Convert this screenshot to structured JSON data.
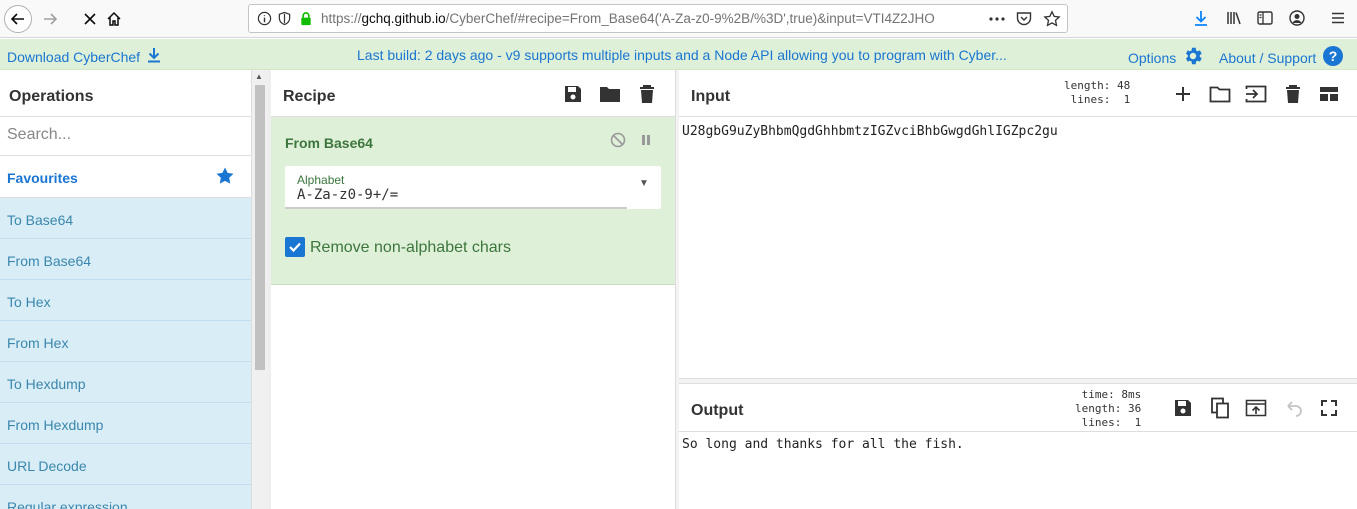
{
  "browser": {
    "url_prefix": "https://",
    "url_host": "gchq.github.io",
    "url_rest": "/CyberChef/#recipe=From_Base64('A-Za-z0-9%2B/%3D',true)&input=VTI4Z2JHO"
  },
  "banner": {
    "download_label": "Download CyberChef",
    "message": "Last build: 2 days ago - v9 supports multiple inputs and a Node API allowing you to program with Cyber...",
    "options_label": "Options",
    "about_label": "About / Support"
  },
  "operations": {
    "title": "Operations",
    "search_placeholder": "Search...",
    "favourites_label": "Favourites",
    "items": [
      "To Base64",
      "From Base64",
      "To Hex",
      "From Hex",
      "To Hexdump",
      "From Hexdump",
      "URL Decode",
      "Regular expression"
    ]
  },
  "recipe": {
    "title": "Recipe",
    "operation": {
      "name": "From Base64",
      "alphabet_label": "Alphabet",
      "alphabet_value": "A-Za-z0-9+/=",
      "remove_label": "Remove non-alphabet chars",
      "remove_checked": true
    }
  },
  "input": {
    "title": "Input",
    "info": "length: 48\n lines:  1",
    "text": "U28gbG9uZyBhbmQgdGhhbmtzIGZvciBhbGwgdGhlIGZpc2gu"
  },
  "output": {
    "title": "Output",
    "info": "time: 8ms\nlength: 36\n lines:  1",
    "text": "So long and thanks for all the fish."
  },
  "colors": {
    "accent": "#1976d2",
    "banner_bg": "#dff0d8",
    "op_item_bg": "#d9edf7",
    "op_text": "#3c763d"
  }
}
